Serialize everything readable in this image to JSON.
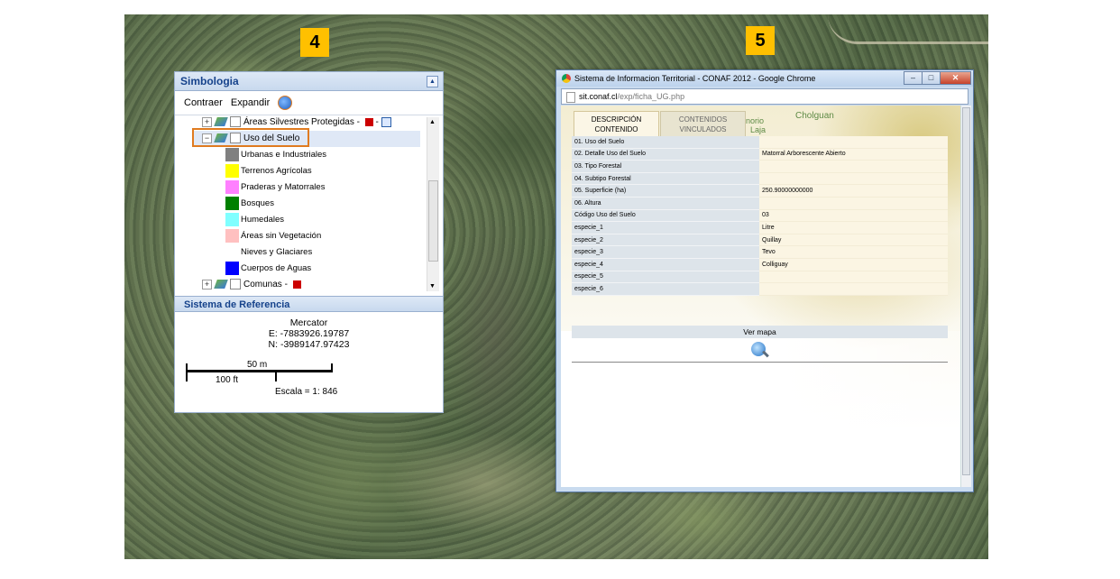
{
  "badges": {
    "left": "4",
    "right": "5"
  },
  "simbologia": {
    "title": "Simbologia",
    "toolbar": {
      "contraer": "Contraer",
      "expandir": "Expandir"
    },
    "tree": {
      "areas_protegidas": "Áreas Silvestres Protegidas -",
      "uso_del_suelo": "Uso del Suelo",
      "comunas": "Comunas -",
      "legend": [
        {
          "label": "Urbanas e Industriales",
          "color": "#808080"
        },
        {
          "label": "Terrenos Agrícolas",
          "color": "#ffff00"
        },
        {
          "label": "Praderas y Matorrales",
          "color": "#ff80ff"
        },
        {
          "label": "Bosques",
          "color": "#008000"
        },
        {
          "label": "Humedales",
          "color": "#80ffff"
        },
        {
          "label": "Áreas sin Vegetación",
          "color": "#ffc0c0"
        },
        {
          "label": "Nieves y Glaciares",
          "color": "#ffffff"
        },
        {
          "label": "Cuerpos de Aguas",
          "color": "#0000ff"
        }
      ]
    },
    "referencia": {
      "title": "Sistema de Referencia",
      "projection": "Mercator",
      "e": "E: -7883926.19787",
      "n": "N: -3989147.97423",
      "scale_metric": "50 m",
      "scale_imperial": "100 ft",
      "escala": "Escala = 1: 846"
    }
  },
  "popup": {
    "window_title": "Sistema de Informacion Territorial - CONAF 2012 - Google Chrome",
    "url_host": "sit.conaf.cl",
    "url_path": "/exp/ficha_UG.php",
    "map_words": [
      "Cholguan",
      "anorio",
      "Laja"
    ],
    "tabs": [
      {
        "line1": "DESCRIPCIÓN",
        "line2": "CONTENIDO"
      },
      {
        "line1": "CONTENIDOS",
        "line2": "VINCULADOS"
      }
    ],
    "rows": [
      {
        "key": "01. Uso del Suelo",
        "value": ""
      },
      {
        "key": "02. Detalle Uso del Suelo",
        "value": "Matorral Arborescente Abierto"
      },
      {
        "key": "03. Tipo Forestal",
        "value": ""
      },
      {
        "key": "04. Subtipo Forestal",
        "value": ""
      },
      {
        "key": "05. Superficie (ha)",
        "value": "250.90000000000"
      },
      {
        "key": "06. Altura",
        "value": ""
      },
      {
        "key": "Código Uso del Suelo",
        "value": "03"
      },
      {
        "key": "especie_1",
        "value": "Litre"
      },
      {
        "key": "especie_2",
        "value": "Quillay"
      },
      {
        "key": "especie_3",
        "value": "Tevo"
      },
      {
        "key": "especie_4",
        "value": "Colliguay"
      },
      {
        "key": "especie_5",
        "value": ""
      },
      {
        "key": "especie_6",
        "value": ""
      }
    ],
    "ver_mapa": "Ver mapa"
  }
}
